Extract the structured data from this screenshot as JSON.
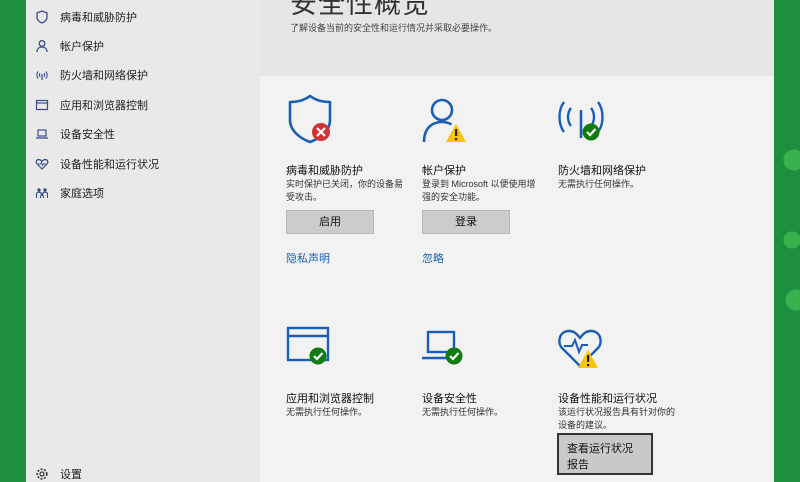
{
  "page": {
    "title": "安全性概览",
    "subtitle": "了解设备当前的安全性和运行情况并采取必要操作。"
  },
  "sidebar": {
    "items": [
      {
        "label": "病毒和威胁防护",
        "icon": "shield-icon"
      },
      {
        "label": "帐户保护",
        "icon": "person-icon"
      },
      {
        "label": "防火墙和网络保护",
        "icon": "wireless-icon"
      },
      {
        "label": "应用和浏览器控制",
        "icon": "browser-window-icon"
      },
      {
        "label": "设备安全性",
        "icon": "laptop-icon"
      },
      {
        "label": "设备性能和运行状况",
        "icon": "heart-icon"
      },
      {
        "label": "家庭选项",
        "icon": "family-icon"
      }
    ],
    "settings_label": "设置"
  },
  "tiles": {
    "virus": {
      "title": "病毒和威胁防护",
      "desc": "实时保护已关闭，你的设备易受攻击。",
      "button": "启用",
      "link": "隐私声明",
      "status": "error"
    },
    "account": {
      "title": "帐户保护",
      "desc": "登录到 Microsoft 以便使用增强的安全功能。",
      "button": "登录",
      "link": "忽略",
      "status": "warning"
    },
    "firewall": {
      "title": "防火墙和网络保护",
      "desc": "无需执行任何操作。",
      "status": "ok"
    },
    "app_browser": {
      "title": "应用和浏览器控制",
      "desc": "无需执行任何操作。",
      "status": "ok"
    },
    "device_security": {
      "title": "设备安全性",
      "desc": "无需执行任何操作。",
      "status": "ok"
    },
    "performance": {
      "title": "设备性能和运行状况",
      "desc": "该运行状况报告具有针对你的设备的建议。",
      "button": "查看运行状况报告",
      "status": "warning"
    }
  },
  "colors": {
    "icon_blue": "#1a5fb4",
    "status_ok": "#107c10",
    "status_error": "#d13438",
    "status_warning": "#f7c600",
    "link": "#1a63b4",
    "desktop_green": "#1f8e3e"
  }
}
